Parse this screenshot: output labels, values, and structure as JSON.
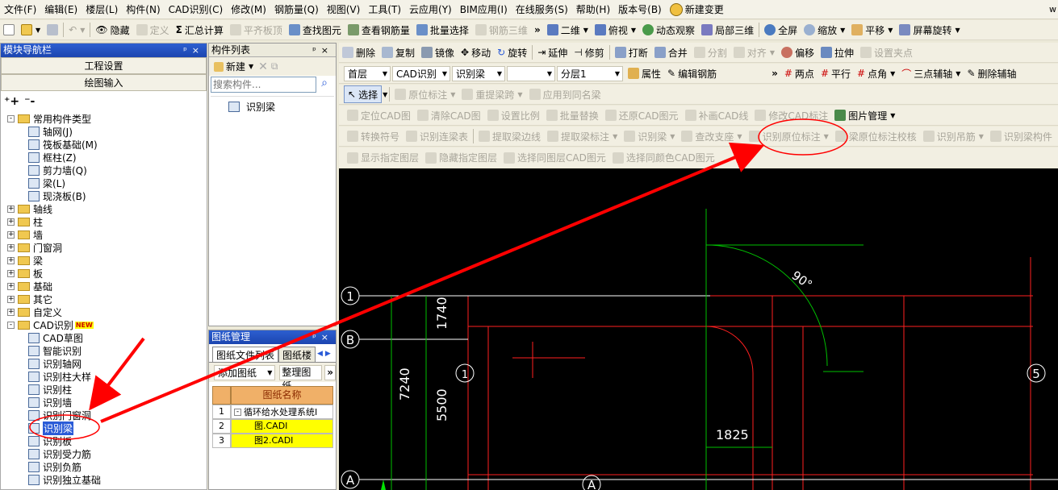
{
  "menubar": {
    "items": [
      "文件(F)",
      "编辑(E)",
      "楼层(L)",
      "构件(N)",
      "CAD识别(C)",
      "修改(M)",
      "钢筋量(Q)",
      "视图(V)",
      "工具(T)",
      "云应用(Y)",
      "BIM应用(I)",
      "在线服务(S)",
      "帮助(H)",
      "版本号(B)"
    ],
    "bell_label": "新建变更",
    "right_text": "w"
  },
  "toolbar1": {
    "hide": "隐藏",
    "define": "定义",
    "summary": "汇总计算",
    "flat_top": "平齐板顶",
    "find": "查找图元",
    "view_rebar": "查看钢筋量",
    "batch_select": "批量选择",
    "rebar3d": "钢筋三维",
    "two_d": "二维",
    "plan_view": "俯视",
    "dyn_obs": "动态观察",
    "local3d": "局部三维",
    "full": "全屏",
    "zoom": "缩放",
    "pan": "平移",
    "rotate_screen": "屏幕旋转"
  },
  "toolbar2": {
    "delete": "删除",
    "copy": "复制",
    "mirror": "镜像",
    "move": "移动",
    "rotate": "旋转",
    "extend": "延伸",
    "trim": "修剪",
    "break": "打断",
    "merge": "合并",
    "split": "分割",
    "align": "对齐",
    "offset": "偏移",
    "stretch": "拉伸",
    "set_grip": "设置夹点"
  },
  "toolbar3": {
    "floor": "首层",
    "cad_identify": "CAD识别",
    "identify_beam": "识别梁",
    "blank": "",
    "layer": "分层1",
    "props": "属性",
    "edit_rebar": "编辑钢筋",
    "two_points": "两点",
    "parallel": "平行",
    "point_angle": "点角",
    "three_point_axis": "三点辅轴",
    "delete_axis": "删除辅轴"
  },
  "toolbar4": {
    "select": "选择",
    "orig_mark": "原位标注",
    "re_span": "重提梁跨",
    "apply_same": "应用到同名梁"
  },
  "toolbar5": {
    "locate_cad": "定位CAD图",
    "clear_cad": "清除CAD图",
    "set_scale": "设置比例",
    "batch_replace": "批量替换",
    "restore_cad": "还原CAD图元",
    "fill_cad_line": "补画CAD线",
    "modify_cad_mark": "修改CAD标注",
    "image_mgmt": "图片管理"
  },
  "toolbar6": {
    "convert_symbol": "转换符号",
    "identify_continuous": "识别连梁表",
    "extract_edge": "提取梁边线",
    "extract_mark": "提取梁标注",
    "identify_beam": "识别梁",
    "check_support": "查改支座",
    "identify_orig_mark": "识别原位标注",
    "orig_mark_check": "梁原位标注校核",
    "identify_hanger": "识别吊筋",
    "identify_beam_struct": "识别梁构件"
  },
  "toolbar7": {
    "show_layer": "显示指定图层",
    "hide_layer": "隐藏指定图层",
    "select_same_layer": "选择同图层CAD图元",
    "select_same_color": "选择同颜色CAD图元"
  },
  "nav_panel": {
    "title": "模块导航栏",
    "btn_project": "工程设置",
    "btn_draw": "绘图输入",
    "tree": [
      {
        "label": "常用构件类型",
        "type": "folder",
        "level": 0,
        "exp": "-"
      },
      {
        "label": "轴网(J)",
        "type": "leaf",
        "level": 1
      },
      {
        "label": "筏板基础(M)",
        "type": "leaf",
        "level": 1
      },
      {
        "label": "框柱(Z)",
        "type": "leaf",
        "level": 1
      },
      {
        "label": "剪力墙(Q)",
        "type": "leaf",
        "level": 1
      },
      {
        "label": "梁(L)",
        "type": "leaf",
        "level": 1
      },
      {
        "label": "现浇板(B)",
        "type": "leaf",
        "level": 1
      },
      {
        "label": "轴线",
        "type": "folder",
        "level": 0,
        "exp": "+"
      },
      {
        "label": "柱",
        "type": "folder",
        "level": 0,
        "exp": "+"
      },
      {
        "label": "墙",
        "type": "folder",
        "level": 0,
        "exp": "+"
      },
      {
        "label": "门窗洞",
        "type": "folder",
        "level": 0,
        "exp": "+"
      },
      {
        "label": "梁",
        "type": "folder",
        "level": 0,
        "exp": "+"
      },
      {
        "label": "板",
        "type": "folder",
        "level": 0,
        "exp": "+"
      },
      {
        "label": "基础",
        "type": "folder",
        "level": 0,
        "exp": "+"
      },
      {
        "label": "其它",
        "type": "folder",
        "level": 0,
        "exp": "+"
      },
      {
        "label": "自定义",
        "type": "folder",
        "level": 0,
        "exp": "+"
      },
      {
        "label": "CAD识别",
        "type": "folder",
        "level": 0,
        "exp": "-",
        "badge": "NEW"
      },
      {
        "label": "CAD草图",
        "type": "leaf",
        "level": 1
      },
      {
        "label": "智能识别",
        "type": "leaf",
        "level": 1
      },
      {
        "label": "识别轴网",
        "type": "leaf",
        "level": 1
      },
      {
        "label": "识别柱大样",
        "type": "leaf",
        "level": 1
      },
      {
        "label": "识别柱",
        "type": "leaf",
        "level": 1
      },
      {
        "label": "识别墙",
        "type": "leaf",
        "level": 1
      },
      {
        "label": "识别门窗洞",
        "type": "leaf",
        "level": 1
      },
      {
        "label": "识别梁",
        "type": "leaf",
        "level": 1,
        "selected": true
      },
      {
        "label": "识别板",
        "type": "leaf",
        "level": 1
      },
      {
        "label": "识别受力筋",
        "type": "leaf",
        "level": 1
      },
      {
        "label": "识别负筋",
        "type": "leaf",
        "level": 1
      },
      {
        "label": "识别独立基础",
        "type": "leaf",
        "level": 1
      }
    ]
  },
  "component_panel": {
    "title": "构件列表",
    "new_btn": "新建",
    "search_placeholder": "搜索构件...",
    "tree_item": "识别梁"
  },
  "drawing_panel": {
    "title": "图纸管理",
    "tab1": "图纸文件列表",
    "tab2": "图纸楼",
    "add": "添加图纸",
    "organize": "整理图纸",
    "col_name": "图纸名称",
    "rows": [
      {
        "num": "1",
        "name": "循环给水处理系统I",
        "exp": "-"
      },
      {
        "num": "2",
        "name": "图.CADI"
      },
      {
        "num": "3",
        "name": "图2.CADI"
      }
    ]
  },
  "canvas": {
    "axis_labels": [
      "1",
      "B",
      "A",
      "1",
      "5",
      "A"
    ],
    "dims": {
      "d1740": "1740",
      "d7240": "7240",
      "d5500": "5500",
      "d1825": "1825",
      "angle": "90°"
    }
  },
  "colors": {
    "accent_blue": "#2a5bd7",
    "canvas_bg": "#000000",
    "cad_red": "#ff0000",
    "cad_green": "#00c000",
    "highlight_yellow": "#ffff00"
  }
}
